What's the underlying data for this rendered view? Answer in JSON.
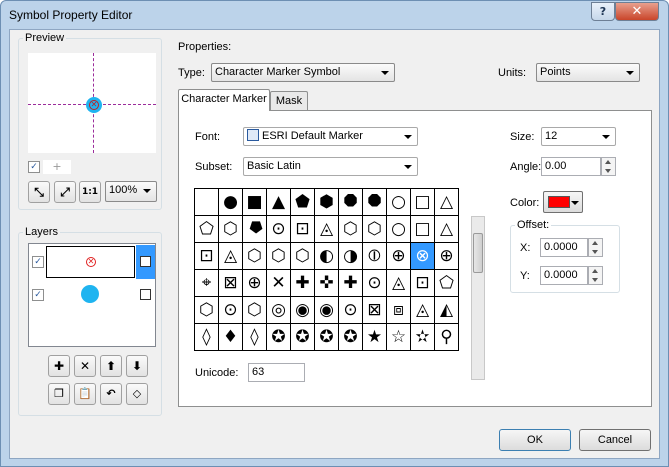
{
  "window": {
    "title": "Symbol Property Editor",
    "help_label": "?",
    "close_label": "✕"
  },
  "preview": {
    "label": "Preview",
    "zoom": "100%",
    "tool_icons": [
      "zoom-in-icon",
      "zoom-out-icon",
      "actual-size-icon"
    ],
    "actual_size_label": "1:1"
  },
  "layers": {
    "label": "Layers",
    "items": [
      {
        "checked": true,
        "symbol_color": "#e02020",
        "selected": true
      },
      {
        "checked": true,
        "symbol_color": "#1fb4f0",
        "selected": false
      }
    ],
    "buttons": [
      "add-layer",
      "remove-layer",
      "move-up",
      "move-down",
      "copy",
      "paste",
      "revert",
      "properties"
    ]
  },
  "properties": {
    "label": "Properties:",
    "type_label": "Type:",
    "type_value": "Character Marker Symbol",
    "units_label": "Units:",
    "units_value": "Points",
    "tabs": [
      {
        "label": "Character Marker",
        "active": true
      },
      {
        "label": "Mask",
        "active": false
      }
    ],
    "font_label": "Font:",
    "font_value": "ESRI Default Marker",
    "subset_label": "Subset:",
    "subset_value": "Basic Latin",
    "unicode_label": "Unicode:",
    "unicode_value": "63",
    "size_label": "Size:",
    "size_value": "12",
    "angle_label": "Angle:",
    "angle_value": "0.00",
    "color_label": "Color:",
    "color_value": "#ff0000",
    "offset_label": "Offset:",
    "x_label": "X:",
    "x_value": "0.0000",
    "y_label": "Y:",
    "y_value": "0.0000"
  },
  "glyphs": [
    [
      " ",
      "●",
      "■",
      "▲",
      "⬟",
      "⬢",
      "⯃",
      "⯃",
      "○",
      "□",
      "△"
    ],
    [
      "⬠",
      "⬡",
      "⯂",
      "⊙",
      "⊡",
      "◬",
      "⬡",
      "⬡",
      "○",
      "□",
      "△"
    ],
    [
      "⊡",
      "◬",
      "⬡",
      "⬡",
      "⬡",
      "◐",
      "◑",
      "⦶",
      "⊕",
      "⊗",
      "⊕"
    ],
    [
      "⌖",
      "⊠",
      "⊕",
      "✕",
      "✚",
      "✜",
      "✚",
      "⊙",
      "◬",
      "⊡",
      "⬠"
    ],
    [
      "⬡",
      "⊙",
      "⬡",
      "◎",
      "◉",
      "◉",
      "⊙",
      "⊠",
      "⧈",
      "◬",
      "◭"
    ],
    [
      "◊",
      "♦",
      "◊",
      "✪",
      "✪",
      "✪",
      "✪",
      "★",
      "☆",
      "✫",
      "⚲"
    ]
  ],
  "selected_glyph": {
    "row": 2,
    "col": 9
  },
  "footer": {
    "ok_label": "OK",
    "cancel_label": "Cancel"
  }
}
